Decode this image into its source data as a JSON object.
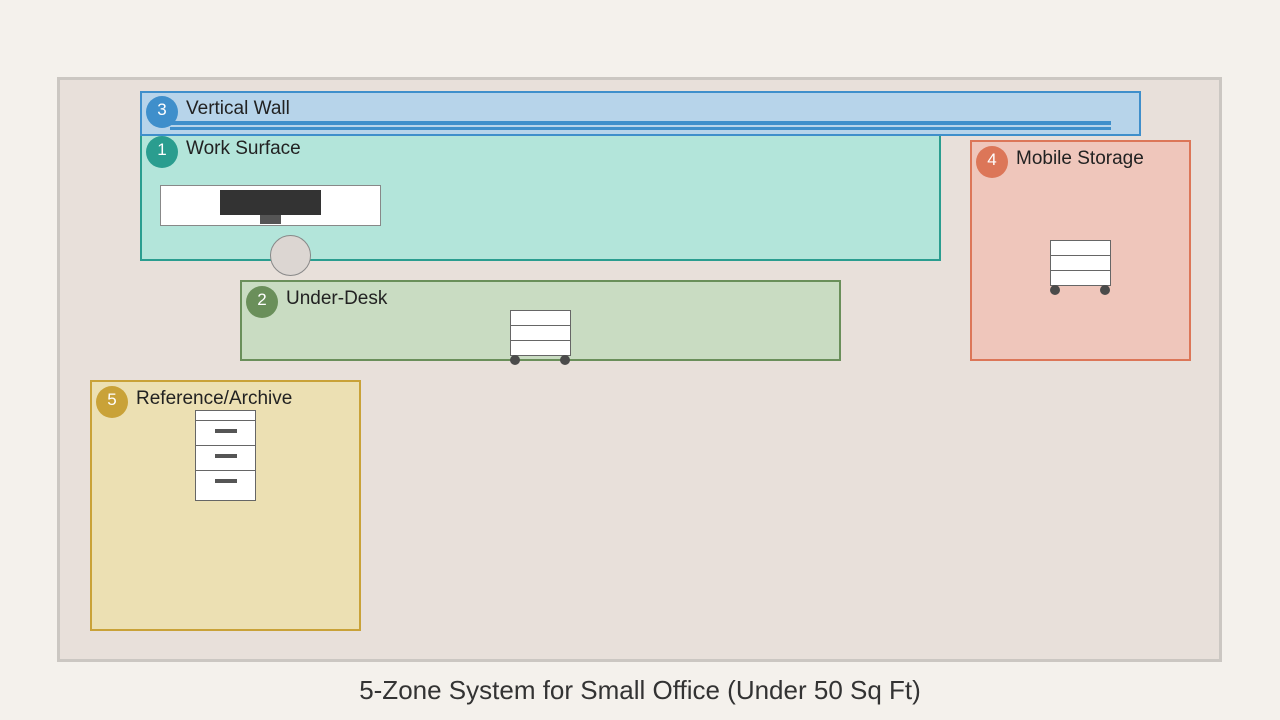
{
  "caption": "5-Zone System for Small Office (Under 50 Sq Ft)",
  "zones": {
    "work_surface": {
      "number": "1",
      "label": "Work Surface",
      "color": "#2a9d8f",
      "fill": "#b3e5da"
    },
    "under_desk": {
      "number": "2",
      "label": "Under-Desk",
      "color": "#6a8f5a",
      "fill": "#c9dcc2"
    },
    "vertical_wall": {
      "number": "3",
      "label": "Vertical Wall",
      "color": "#3f8fcb",
      "fill": "#b7d4ea"
    },
    "mobile_storage": {
      "number": "4",
      "label": "Mobile Storage",
      "color": "#dc7658",
      "fill": "#efc6bb"
    },
    "reference_archive": {
      "number": "5",
      "label": "Reference/Archive",
      "color": "#c9a238",
      "fill": "#ece0b3"
    }
  }
}
